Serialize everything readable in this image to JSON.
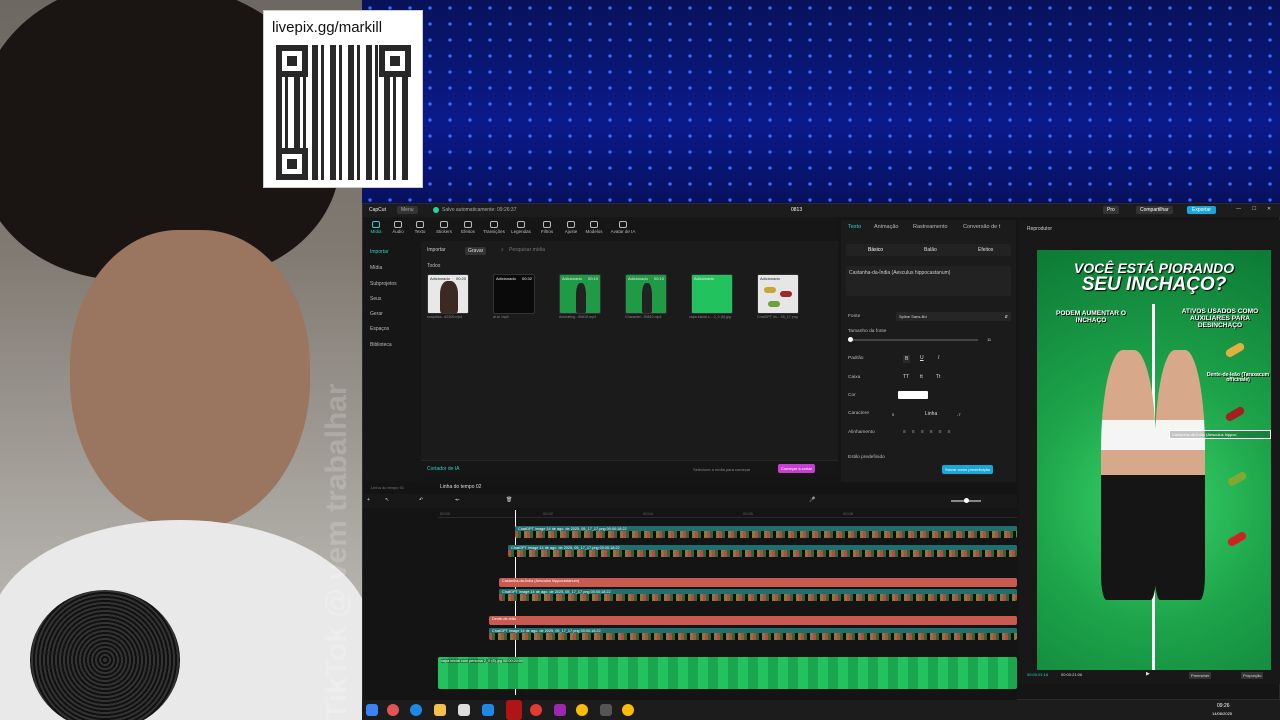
{
  "overlay": {
    "donation_url": "livepix.gg/markill",
    "watermark_text": "TikTok @ vem trabalhar"
  },
  "window": {
    "app_name": "CapCut",
    "menu": "Menu",
    "autosave": "Salvo automaticamente: 09:26:37",
    "project_title": "0813",
    "pro": "Pro",
    "share": "Compartilhar",
    "export": "Exportar"
  },
  "toolbar": {
    "items": [
      "Mídia",
      "Áudio",
      "Texto",
      "Stickers",
      "Efeitos",
      "Transições",
      "Legendas",
      "Filtros",
      "Ajuste",
      "Modelos",
      "Avatar de IA"
    ]
  },
  "leftnav": {
    "items": [
      "Importar",
      "Mídia",
      "Subprojetos",
      "Seus",
      "Gerar",
      "Espaços",
      "Biblioteca"
    ]
  },
  "media": {
    "import_label": "Importar",
    "record_label": "Gravar",
    "search_placeholder": "Pesquisar mídia",
    "section": "Todos",
    "clips": [
      {
        "badge": "Adicionado",
        "duration": "00:20",
        "name": "snapticta...62309.mp4",
        "color": "#e8e8e8"
      },
      {
        "badge": "Adicionado",
        "duration": "00:32",
        "name": "ai ai .mp4",
        "color": "#0a0a0a"
      },
      {
        "badge": "Adicionado",
        "duration": "00:10",
        "name": "Animating...90810.mp4",
        "color": "#1f9a45"
      },
      {
        "badge": "Adicionado",
        "duration": "00:10",
        "name": "Character...90810.mp4",
        "color": "#1f9a45"
      },
      {
        "badge": "Adicionado",
        "duration": "",
        "name": "capa inicial c... 2_0 (8).jpg",
        "color": "#22c35e"
      },
      {
        "badge": "Adicionado",
        "duration": "",
        "name": "ChatGPT im... 05_17.png",
        "color": "#e6e6e6"
      }
    ],
    "ai_cutter": "Cortador de IA",
    "cutter_hint": "Selecione a mídia para começar",
    "cutter_button": "Começar a cortar"
  },
  "properties": {
    "tabs": [
      "Texto",
      "Animação",
      "Rastreamento",
      "Conversão de t"
    ],
    "subtabs": [
      "Básico",
      "Balão",
      "Efeitos"
    ],
    "text_value": "Castanha-da-Índia (Aesculus hippocastanum)",
    "font_label": "Fonte",
    "font_value": "Spline Sans-Bd",
    "size_label": "Tamanho da fonte",
    "size_value": "11",
    "pattern_label": "Padrão",
    "case_label": "Caixa",
    "color_label": "Cor",
    "char_label": "Caractere",
    "char_value": "0",
    "line_label": "Linha",
    "line_value": "-7",
    "align_label": "Alinhamento",
    "preset_label": "Estilo predefinido",
    "save_preset": "Salvar como predefinição"
  },
  "player": {
    "title": "Reprodutor",
    "headline_1": "VOCÊ ESTÁ PIORANDO",
    "headline_2": "SEU INCHAÇO?",
    "left_caption": "PODEM AUMENTAR O INCHAÇO",
    "right_caption": "ATIVOS USADOS COMO AUXILIARES PARA DESINCHAÇO",
    "tag_1": "Dente-de-leão (Taraxacum officinale)",
    "tag_2": "Castanha-da-Índia (Aesculus hippoc",
    "time_current": "00:00:01:16",
    "time_total": "00:00:21:06",
    "full_label": "Preencher",
    "ratio_label": "Proporção"
  },
  "timeline": {
    "title": "Linha do tempo 02",
    "prev_title": "Linha do tempo 01",
    "ticks": [
      "00:00",
      "00:02",
      "00:04",
      "00:06",
      "00:08"
    ],
    "tracks": [
      "ChatGPT Image 14 de ago. de 2025, 05_17_17.png 00:00:18:22",
      "ChatGPT Image 14 de ago. de 2025, 05_17_17.png 00:00:18:22",
      "Castanha-da-Índia (Aesculus hippocastanum)",
      "ChatGPT Image 14 de ago. de 2025, 05_17_17.png 00:00:18:22",
      "Dente-de-leão",
      "ChatGPT Image 14 de ago. de 2025, 05_17_17.png 00:00:18:22",
      "capa inicial com persona 2_0 (8).jpg 00:00:20:00"
    ]
  },
  "taskbar": {
    "time": "09:26",
    "date": "14/08/2025"
  }
}
